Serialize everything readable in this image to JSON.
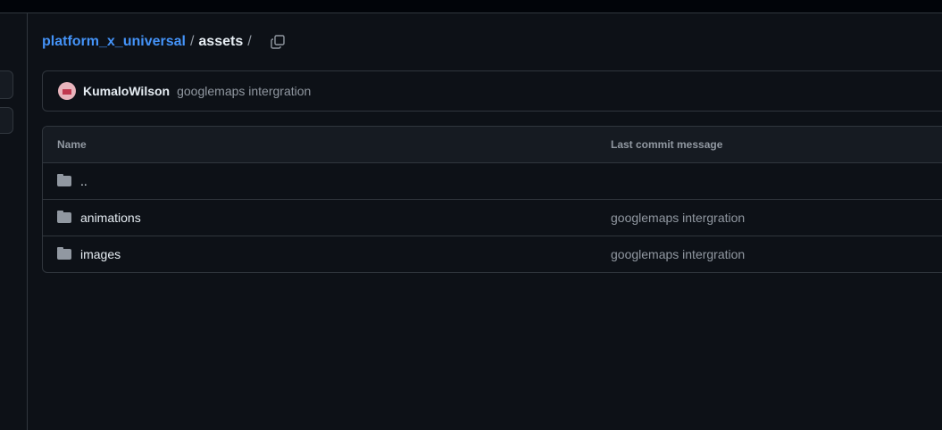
{
  "breadcrumb": {
    "repo": "platform_x_universal",
    "folder": "assets",
    "separator": "/"
  },
  "latest_commit": {
    "author": "KumaloWilson",
    "message": "googlemaps intergration"
  },
  "table": {
    "headers": [
      "Name",
      "Last commit message"
    ],
    "rows": [
      {
        "name": "..",
        "message": ""
      },
      {
        "name": "animations",
        "message": "googlemaps intergration"
      },
      {
        "name": "images",
        "message": "googlemaps intergration"
      }
    ]
  }
}
